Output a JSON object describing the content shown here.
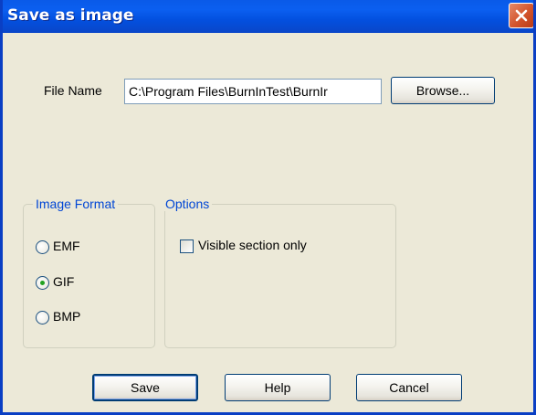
{
  "window": {
    "title": "Save as image",
    "close_icon": "close-icon"
  },
  "file": {
    "label": "File Name",
    "value": "C:\\Program Files\\BurnInTest\\BurnIr",
    "browse_label": "Browse..."
  },
  "image_format": {
    "legend": "Image Format",
    "options": [
      "EMF",
      "GIF",
      "BMP"
    ],
    "selected": "GIF"
  },
  "options": {
    "legend": "Options",
    "visible_section_only": {
      "label": "Visible section only",
      "checked": false
    }
  },
  "buttons": {
    "save": "Save",
    "help": "Help",
    "cancel": "Cancel"
  },
  "colors": {
    "titlebar": "#0a5ae8",
    "dialog_bg": "#ece9d8",
    "groupbox_legend": "#0046d5",
    "close_button": "#d3542c"
  }
}
